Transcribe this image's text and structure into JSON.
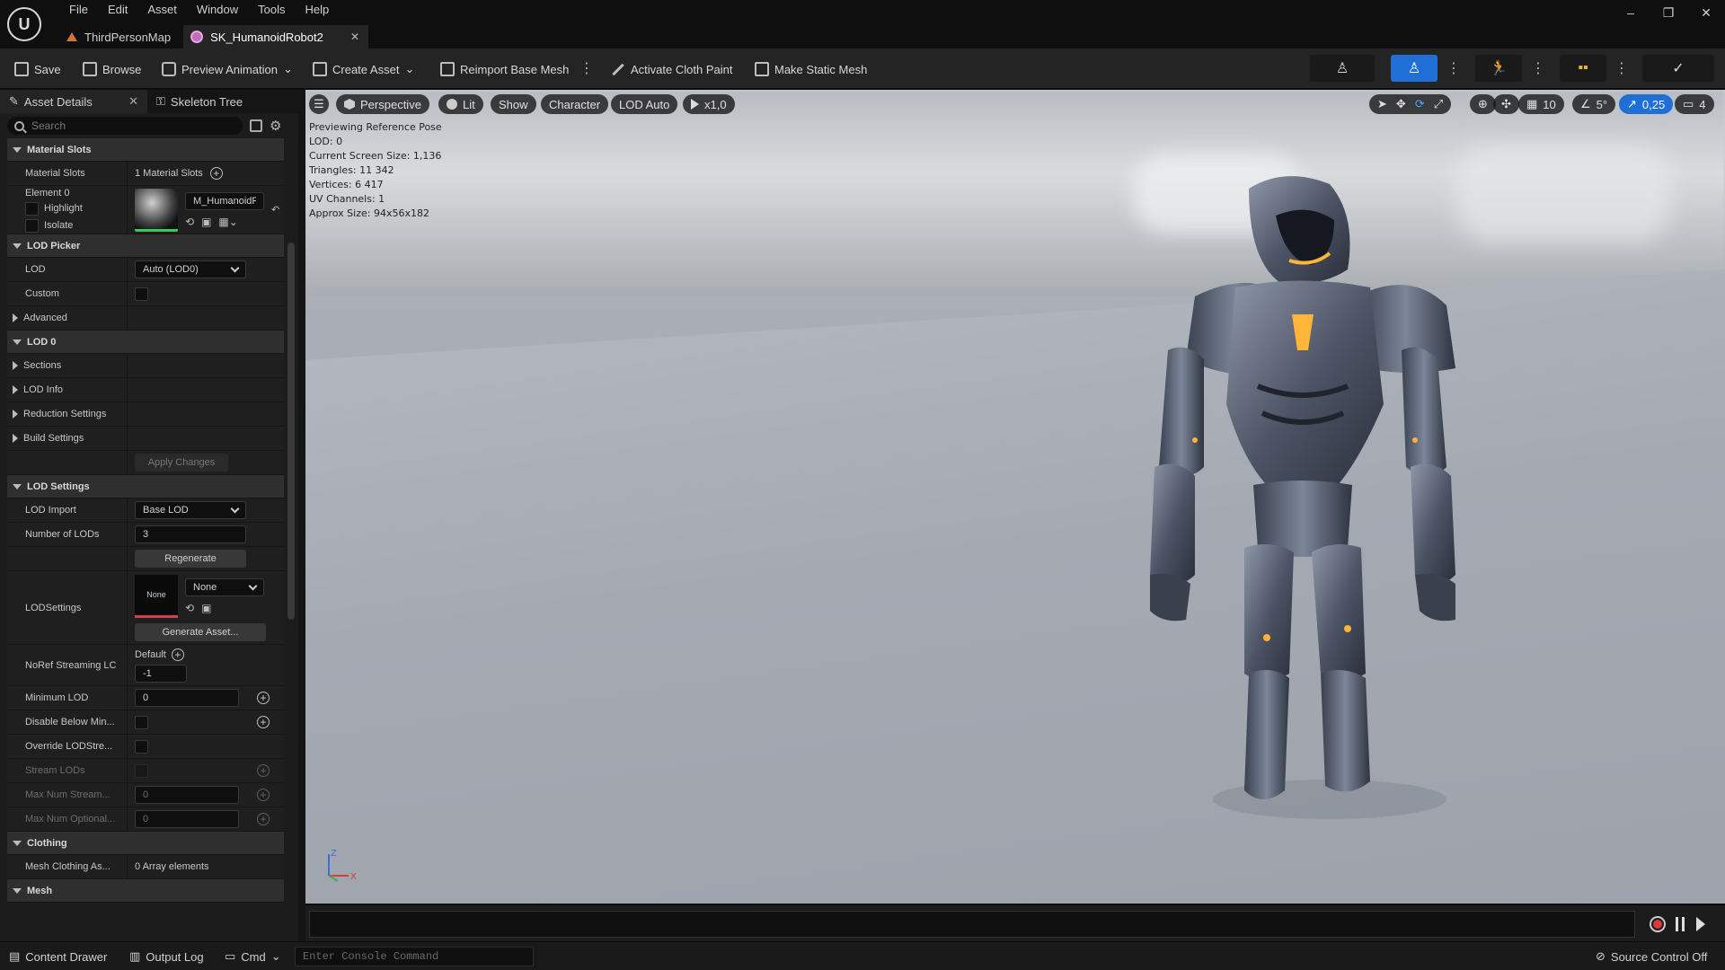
{
  "menu": [
    "File",
    "Edit",
    "Asset",
    "Window",
    "Tools",
    "Help"
  ],
  "tabs": [
    {
      "label": "ThirdPersonMap",
      "active": false
    },
    {
      "label": "SK_HumanoidRobot2",
      "active": true
    }
  ],
  "toolbar": {
    "save": "Save",
    "browse": "Browse",
    "preview_animation": "Preview Animation",
    "create_asset": "Create Asset",
    "reimport": "Reimport Base Mesh",
    "activate_cloth": "Activate Cloth Paint",
    "make_static": "Make Static Mesh"
  },
  "panel_tabs": {
    "details": "Asset Details",
    "skeleton": "Skeleton Tree"
  },
  "search": {
    "placeholder": "Search"
  },
  "material_slots": {
    "section": "Material Slots",
    "label": "Material Slots",
    "value": "1 Material Slots",
    "element": "Element 0",
    "highlight": "Highlight",
    "isolate": "Isolate",
    "material_name": "M_HumanoidRob"
  },
  "lod_picker": {
    "section": "LOD Picker",
    "lod_label": "LOD",
    "lod_value": "Auto (LOD0)",
    "custom_label": "Custom",
    "advanced": "Advanced"
  },
  "lod0": {
    "section": "LOD 0",
    "sections": "Sections",
    "lod_info": "LOD Info",
    "reduction": "Reduction Settings",
    "build": "Build Settings",
    "apply": "Apply Changes"
  },
  "lod_settings": {
    "section": "LOD Settings",
    "import_label": "LOD Import",
    "import_value": "Base LOD",
    "num_lods_label": "Number of LODs",
    "num_lods_value": "3",
    "regenerate": "Regenerate",
    "lodsettings_label": "LODSettings",
    "lodsettings_thumb": "None",
    "lodsettings_value": "None",
    "generate": "Generate Asset...",
    "noref_label": "NoRef Streaming LC",
    "noref_default": "Default",
    "noref_value": "-1",
    "min_lod_label": "Minimum LOD",
    "min_lod_value": "0",
    "disable_below_label": "Disable Below Min...",
    "override_label": "Override LODStre...",
    "stream_lods_label": "Stream LODs",
    "max_stream_label": "Max Num Stream...",
    "max_stream_value": "0",
    "max_optional_label": "Max Num Optional...",
    "max_optional_value": "0"
  },
  "clothing": {
    "section": "Clothing",
    "label": "Mesh Clothing As...",
    "value": "0 Array elements"
  },
  "mesh": {
    "section": "Mesh"
  },
  "viewport": {
    "perspective": "Perspective",
    "lit": "Lit",
    "show": "Show",
    "character": "Character",
    "lod_auto": "LOD Auto",
    "speed": "x1,0",
    "grid_size": "10",
    "angle": "5°",
    "scale": "0,25",
    "camera_speed": "4",
    "stats": [
      "Previewing Reference Pose",
      "LOD: 0",
      "Current Screen Size: 1,136",
      "Triangles: 11 342",
      "Vertices: 6 417",
      "UV Channels: 1",
      "Approx Size: 94x56x182"
    ],
    "axis_z": "Z",
    "axis_x": "X"
  },
  "statusbar": {
    "content_drawer": "Content Drawer",
    "output_log": "Output Log",
    "cmd": "Cmd",
    "console_placeholder": "Enter Console Command",
    "source_control": "Source Control Off"
  },
  "colors": {
    "accent": "#1f6fd6",
    "glow": "#ffb43a",
    "bg": "#151515"
  }
}
